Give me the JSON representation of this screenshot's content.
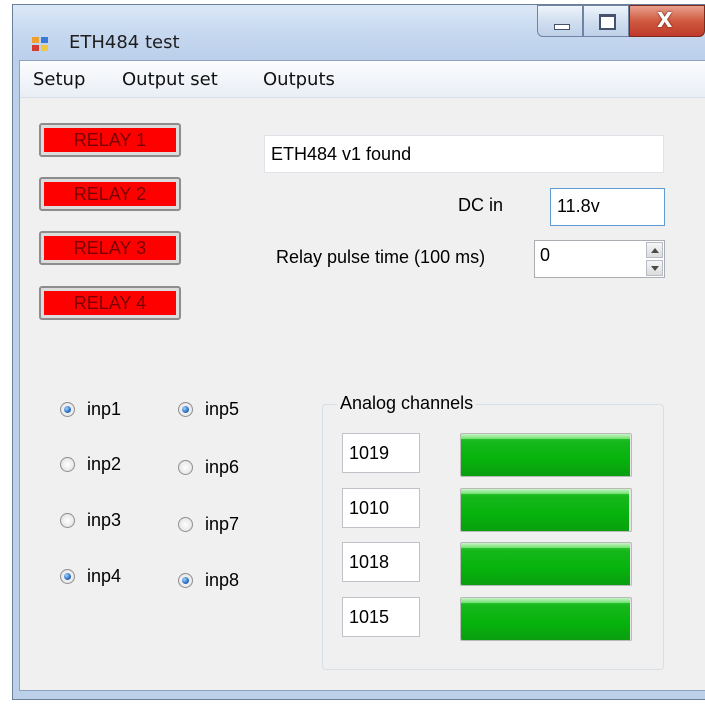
{
  "window": {
    "title": "ETH484 test",
    "close_glyph": "X"
  },
  "menu": {
    "items": [
      "Setup",
      "Output set",
      "Outputs"
    ]
  },
  "relays": [
    {
      "label": "RELAY 1",
      "state": "off",
      "color": "#ff0000"
    },
    {
      "label": "RELAY 2",
      "state": "off",
      "color": "#ff0000"
    },
    {
      "label": "RELAY 3",
      "state": "off",
      "color": "#ff0000"
    },
    {
      "label": "RELAY 4",
      "state": "off",
      "color": "#ff0000"
    }
  ],
  "status": {
    "text": "ETH484 v1 found"
  },
  "dc": {
    "label": "DC in",
    "value": "11.8v"
  },
  "pulse": {
    "label": "Relay pulse time (100 ms)",
    "value": "0"
  },
  "inputs": [
    {
      "label": "inp1",
      "checked": true
    },
    {
      "label": "inp2",
      "checked": false
    },
    {
      "label": "inp3",
      "checked": false
    },
    {
      "label": "inp4",
      "checked": true
    },
    {
      "label": "inp5",
      "checked": true
    },
    {
      "label": "inp6",
      "checked": false
    },
    {
      "label": "inp7",
      "checked": false
    },
    {
      "label": "inp8",
      "checked": true
    }
  ],
  "analog": {
    "title": "Analog channels",
    "max": 1023,
    "bar_color": "#06b30c",
    "channels": [
      {
        "value": "1019",
        "level": 1019
      },
      {
        "value": "1010",
        "level": 1010
      },
      {
        "value": "1018",
        "level": 1018
      },
      {
        "value": "1015",
        "level": 1015
      }
    ]
  }
}
